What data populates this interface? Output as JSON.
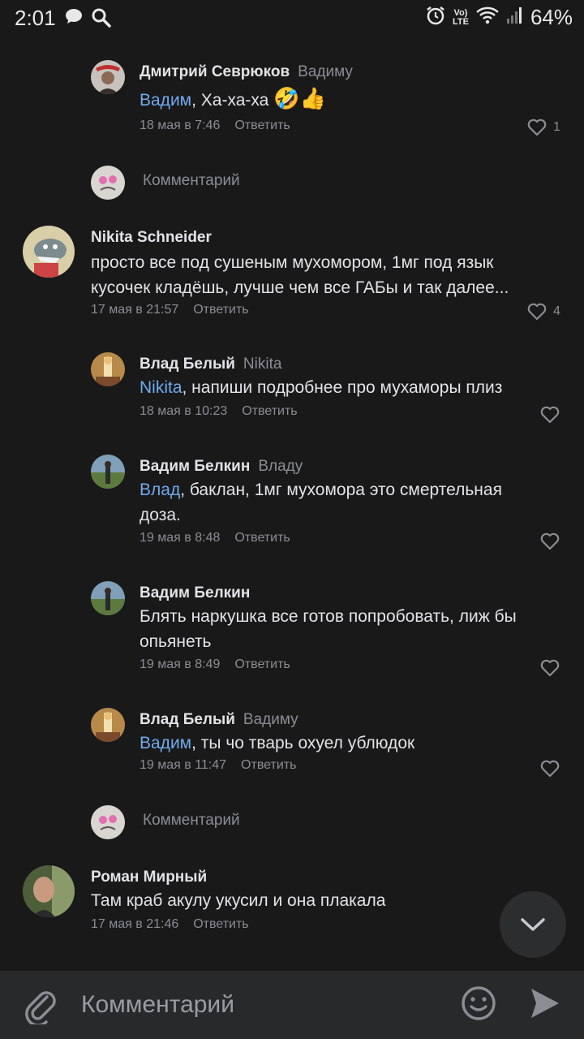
{
  "status_bar": {
    "time": "2:01",
    "battery": "64%",
    "volte_top": "Vo)",
    "volte_bottom": "LTE"
  },
  "comments": [
    {
      "author": "Дмитрий Севрюков",
      "reply_to": "Вадиму",
      "mention": "Вадим",
      "text": ", Ха-ха-ха",
      "emoji": "🤣👍",
      "date": "18 мая в 7:46",
      "reply_label": "Ответить",
      "likes": "1"
    },
    {
      "author": "Nikita Schneider",
      "text_lines": [
        "просто все под сушеным мухомором, 1мг под язык",
        "кусочек кладёшь, лучше чем все ГАБы и так далее..."
      ],
      "date": "17 мая в 21:57",
      "reply_label": "Ответить",
      "likes": "4"
    },
    {
      "author": "Влад Белый",
      "reply_to": "Nikita",
      "mention": "Nikita",
      "text": ", напиши подробнее про мухаморы плиз",
      "date": "18 мая в 10:23",
      "reply_label": "Ответить"
    },
    {
      "author": "Вадим Белкин",
      "reply_to": "Владу",
      "mention": "Влад",
      "text": ", баклан, 1мг мухомора это смертельная",
      "text2": "доза.",
      "date": "19 мая в 8:48",
      "reply_label": "Ответить"
    },
    {
      "author": "Вадим Белкин",
      "text_lines": [
        "Блять наркушка все готов попробовать, лиж бы",
        "опьянеть"
      ],
      "date": "19 мая в 8:49",
      "reply_label": "Ответить"
    },
    {
      "author": "Влад Белый",
      "reply_to": "Вадиму",
      "mention": "Вадим",
      "text": ", ты чо тварь охуел ублюдок",
      "date": "19 мая в 11:47",
      "reply_label": "Ответить"
    },
    {
      "author": "Роман Мирный",
      "text": "Там краб акулу укусил и она плакала",
      "date": "17 мая в 21:46",
      "reply_label": "Ответить"
    }
  ],
  "add_comment_placeholder_1": "Комментарий",
  "add_comment_placeholder_2": "Комментарий",
  "composer": {
    "placeholder": "Комментарий"
  }
}
